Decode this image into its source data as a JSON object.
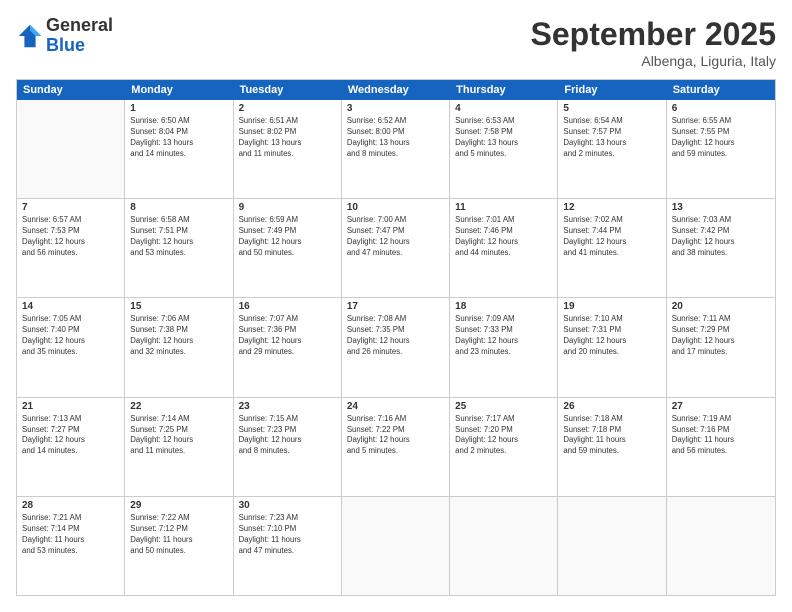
{
  "logo": {
    "general": "General",
    "blue": "Blue"
  },
  "header": {
    "month": "September 2025",
    "location": "Albenga, Liguria, Italy"
  },
  "weekdays": [
    "Sunday",
    "Monday",
    "Tuesday",
    "Wednesday",
    "Thursday",
    "Friday",
    "Saturday"
  ],
  "weeks": [
    [
      {
        "day": "",
        "info": ""
      },
      {
        "day": "1",
        "info": "Sunrise: 6:50 AM\nSunset: 8:04 PM\nDaylight: 13 hours\nand 14 minutes."
      },
      {
        "day": "2",
        "info": "Sunrise: 6:51 AM\nSunset: 8:02 PM\nDaylight: 13 hours\nand 11 minutes."
      },
      {
        "day": "3",
        "info": "Sunrise: 6:52 AM\nSunset: 8:00 PM\nDaylight: 13 hours\nand 8 minutes."
      },
      {
        "day": "4",
        "info": "Sunrise: 6:53 AM\nSunset: 7:58 PM\nDaylight: 13 hours\nand 5 minutes."
      },
      {
        "day": "5",
        "info": "Sunrise: 6:54 AM\nSunset: 7:57 PM\nDaylight: 13 hours\nand 2 minutes."
      },
      {
        "day": "6",
        "info": "Sunrise: 6:55 AM\nSunset: 7:55 PM\nDaylight: 12 hours\nand 59 minutes."
      }
    ],
    [
      {
        "day": "7",
        "info": "Sunrise: 6:57 AM\nSunset: 7:53 PM\nDaylight: 12 hours\nand 56 minutes."
      },
      {
        "day": "8",
        "info": "Sunrise: 6:58 AM\nSunset: 7:51 PM\nDaylight: 12 hours\nand 53 minutes."
      },
      {
        "day": "9",
        "info": "Sunrise: 6:59 AM\nSunset: 7:49 PM\nDaylight: 12 hours\nand 50 minutes."
      },
      {
        "day": "10",
        "info": "Sunrise: 7:00 AM\nSunset: 7:47 PM\nDaylight: 12 hours\nand 47 minutes."
      },
      {
        "day": "11",
        "info": "Sunrise: 7:01 AM\nSunset: 7:46 PM\nDaylight: 12 hours\nand 44 minutes."
      },
      {
        "day": "12",
        "info": "Sunrise: 7:02 AM\nSunset: 7:44 PM\nDaylight: 12 hours\nand 41 minutes."
      },
      {
        "day": "13",
        "info": "Sunrise: 7:03 AM\nSunset: 7:42 PM\nDaylight: 12 hours\nand 38 minutes."
      }
    ],
    [
      {
        "day": "14",
        "info": "Sunrise: 7:05 AM\nSunset: 7:40 PM\nDaylight: 12 hours\nand 35 minutes."
      },
      {
        "day": "15",
        "info": "Sunrise: 7:06 AM\nSunset: 7:38 PM\nDaylight: 12 hours\nand 32 minutes."
      },
      {
        "day": "16",
        "info": "Sunrise: 7:07 AM\nSunset: 7:36 PM\nDaylight: 12 hours\nand 29 minutes."
      },
      {
        "day": "17",
        "info": "Sunrise: 7:08 AM\nSunset: 7:35 PM\nDaylight: 12 hours\nand 26 minutes."
      },
      {
        "day": "18",
        "info": "Sunrise: 7:09 AM\nSunset: 7:33 PM\nDaylight: 12 hours\nand 23 minutes."
      },
      {
        "day": "19",
        "info": "Sunrise: 7:10 AM\nSunset: 7:31 PM\nDaylight: 12 hours\nand 20 minutes."
      },
      {
        "day": "20",
        "info": "Sunrise: 7:11 AM\nSunset: 7:29 PM\nDaylight: 12 hours\nand 17 minutes."
      }
    ],
    [
      {
        "day": "21",
        "info": "Sunrise: 7:13 AM\nSunset: 7:27 PM\nDaylight: 12 hours\nand 14 minutes."
      },
      {
        "day": "22",
        "info": "Sunrise: 7:14 AM\nSunset: 7:25 PM\nDaylight: 12 hours\nand 11 minutes."
      },
      {
        "day": "23",
        "info": "Sunrise: 7:15 AM\nSunset: 7:23 PM\nDaylight: 12 hours\nand 8 minutes."
      },
      {
        "day": "24",
        "info": "Sunrise: 7:16 AM\nSunset: 7:22 PM\nDaylight: 12 hours\nand 5 minutes."
      },
      {
        "day": "25",
        "info": "Sunrise: 7:17 AM\nSunset: 7:20 PM\nDaylight: 12 hours\nand 2 minutes."
      },
      {
        "day": "26",
        "info": "Sunrise: 7:18 AM\nSunset: 7:18 PM\nDaylight: 11 hours\nand 59 minutes."
      },
      {
        "day": "27",
        "info": "Sunrise: 7:19 AM\nSunset: 7:16 PM\nDaylight: 11 hours\nand 56 minutes."
      }
    ],
    [
      {
        "day": "28",
        "info": "Sunrise: 7:21 AM\nSunset: 7:14 PM\nDaylight: 11 hours\nand 53 minutes."
      },
      {
        "day": "29",
        "info": "Sunrise: 7:22 AM\nSunset: 7:12 PM\nDaylight: 11 hours\nand 50 minutes."
      },
      {
        "day": "30",
        "info": "Sunrise: 7:23 AM\nSunset: 7:10 PM\nDaylight: 11 hours\nand 47 minutes."
      },
      {
        "day": "",
        "info": ""
      },
      {
        "day": "",
        "info": ""
      },
      {
        "day": "",
        "info": ""
      },
      {
        "day": "",
        "info": ""
      }
    ]
  ]
}
